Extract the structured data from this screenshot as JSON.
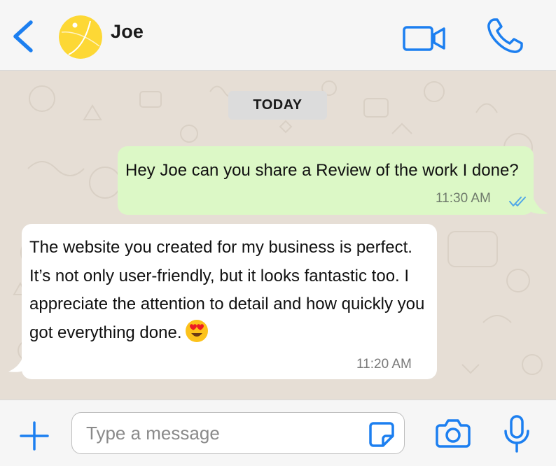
{
  "header": {
    "contact_name": "Joe",
    "back_icon": "chevron-left-icon",
    "video_icon": "video-camera-icon",
    "call_icon": "phone-icon"
  },
  "chat": {
    "date_label": "TODAY",
    "messages": [
      {
        "direction": "outgoing",
        "text": "Hey Joe can you share a Review of the work I done?",
        "time": "11:30 AM",
        "status_icon": "double-check-icon"
      },
      {
        "direction": "incoming",
        "text": "The website you created for my business is perfect. It’s not only user-friendly, but it looks fantastic too. I appreciate the attention to detail and how quickly you got everything done.",
        "emoji": "heart-eyes-emoji",
        "time": "11:20 AM"
      }
    ]
  },
  "composer": {
    "placeholder": "Type a message",
    "attach_icon": "plus-icon",
    "sticker_icon": "sticker-icon",
    "camera_icon": "camera-icon",
    "mic_icon": "microphone-icon"
  },
  "colors": {
    "accent": "#1c7ff0",
    "outgoing_bubble": "#dcf8c6",
    "incoming_bubble": "#ffffff",
    "chat_background": "#e6ded5",
    "avatar": "#fdd835",
    "read_ticks": "#4fa6e8"
  }
}
